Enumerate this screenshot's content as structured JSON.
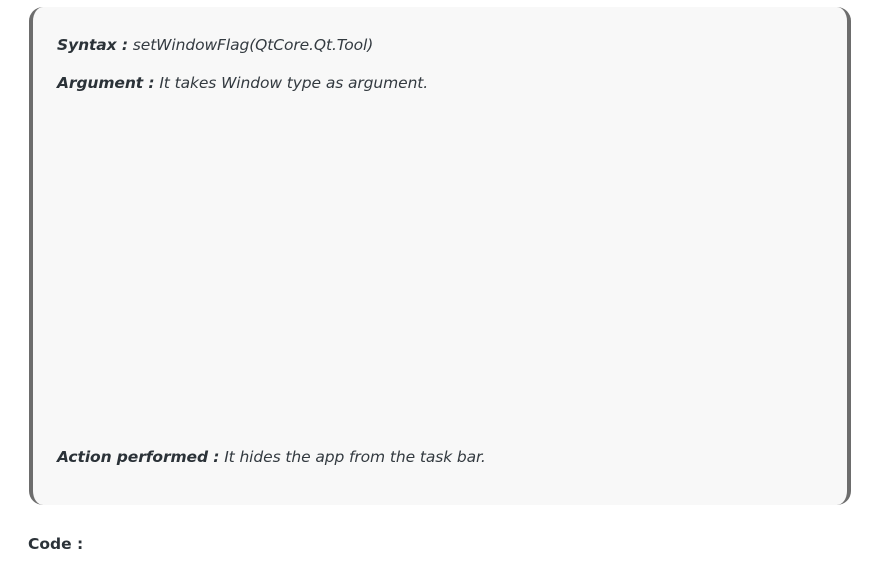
{
  "note": {
    "syntax": {
      "label": "Syntax :",
      "value": "setWindowFlag(QtCore.Qt.Tool)"
    },
    "argument": {
      "label": "Argument :",
      "value": "It takes Window type as argument."
    },
    "action": {
      "label": "Action performed :",
      "value": "It hides the app from the task bar."
    }
  },
  "code_heading": "Code :",
  "colors": {
    "box_background": "#f8f8f8",
    "box_border": "#6d6d6d",
    "text": "#333a40"
  }
}
